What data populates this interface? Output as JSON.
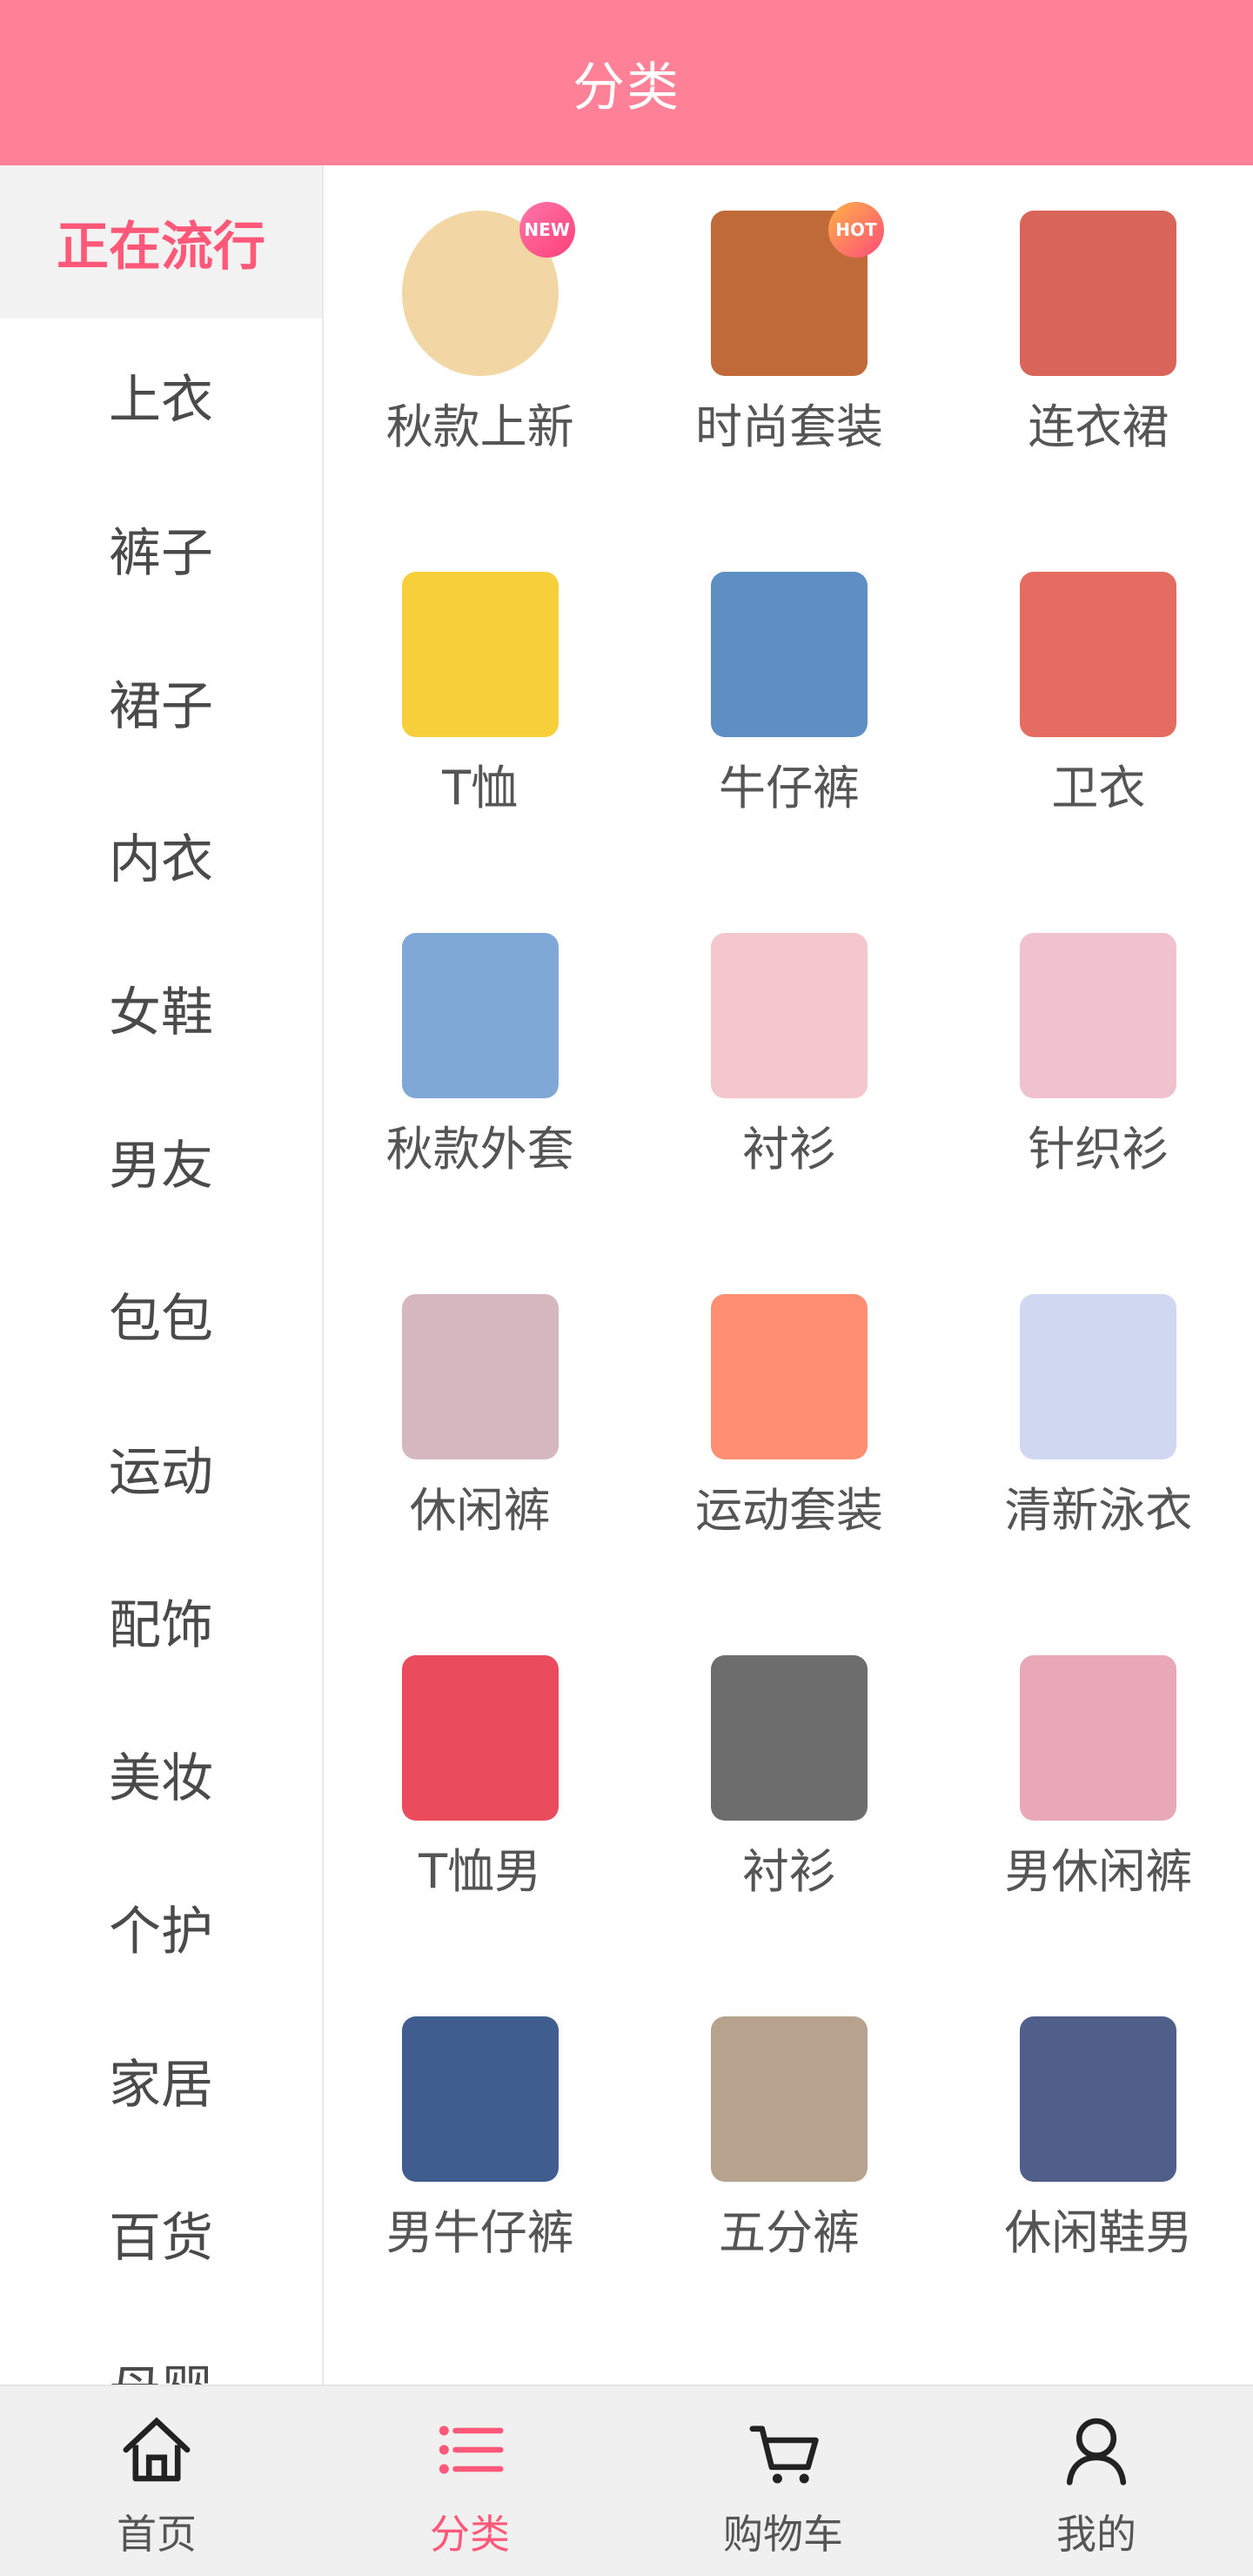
{
  "header": {
    "title": "分类"
  },
  "sidebar": {
    "items": [
      {
        "label": "正在流行",
        "active": true
      },
      {
        "label": "上衣"
      },
      {
        "label": "裤子"
      },
      {
        "label": "裙子"
      },
      {
        "label": "内衣"
      },
      {
        "label": "女鞋"
      },
      {
        "label": "男友"
      },
      {
        "label": "包包"
      },
      {
        "label": "运动"
      },
      {
        "label": "配饰"
      },
      {
        "label": "美妆"
      },
      {
        "label": "个护"
      },
      {
        "label": "家居"
      },
      {
        "label": "百货"
      },
      {
        "label": "母婴"
      }
    ]
  },
  "grid": {
    "items": [
      {
        "label": "秋款上新",
        "badge": "NEW",
        "color": "#f2d7a4"
      },
      {
        "label": "时尚套装",
        "badge": "HOT",
        "color": "#c06a3a"
      },
      {
        "label": "连衣裙",
        "color": "#d9645a"
      },
      {
        "label": "T恤",
        "color": "#f7cf3b"
      },
      {
        "label": "牛仔裤",
        "color": "#5d8ec4"
      },
      {
        "label": "卫衣",
        "color": "#e46c60"
      },
      {
        "label": "秋款外套",
        "color": "#7fa8d6"
      },
      {
        "label": "衬衫",
        "color": "#f3c7cb"
      },
      {
        "label": "针织衫",
        "color": "#f0c1cf"
      },
      {
        "label": "休闲裤",
        "color": "#d7b7bf"
      },
      {
        "label": "运动套装",
        "color": "#ff8e73"
      },
      {
        "label": "清新泳衣",
        "color": "#cfd8f0"
      },
      {
        "label": "T恤男",
        "color": "#ea4c5d"
      },
      {
        "label": "衬衫",
        "color": "#6d6d6d"
      },
      {
        "label": "男休闲裤",
        "color": "#e8a8b8"
      },
      {
        "label": "男牛仔裤",
        "color": "#3f5d8f"
      },
      {
        "label": "五分裤",
        "color": "#b7a28e"
      },
      {
        "label": "休闲鞋男",
        "color": "#4f5f8a"
      }
    ]
  },
  "bottom_nav": {
    "items": [
      {
        "label": "首页",
        "icon": "home-icon"
      },
      {
        "label": "分类",
        "icon": "list-icon",
        "active": true
      },
      {
        "label": "购物车",
        "icon": "cart-icon"
      },
      {
        "label": "我的",
        "icon": "user-icon"
      }
    ]
  },
  "colors": {
    "header": "#FF8198",
    "accent": "#FF5878"
  }
}
